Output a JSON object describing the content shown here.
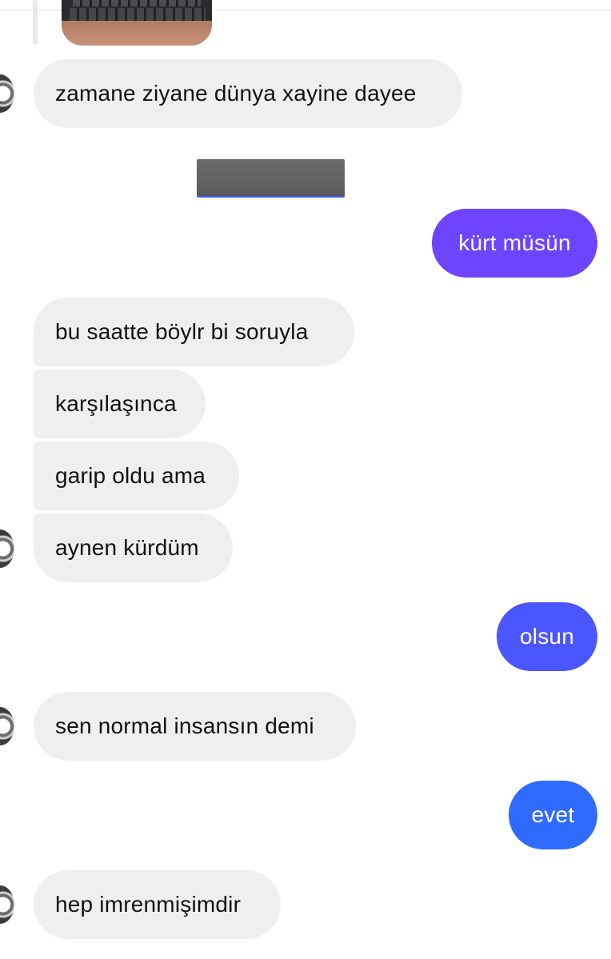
{
  "thread": {
    "messages": [
      {
        "id": "m1",
        "side": "incoming",
        "text": "zamane ziyane dünya xayine dayee"
      },
      {
        "id": "m2",
        "side": "outgoing",
        "text": "kürt müsün",
        "color": "#6e44ff"
      },
      {
        "id": "m3",
        "side": "incoming",
        "text": "bu saatte böylr bi soruyla"
      },
      {
        "id": "m4",
        "side": "incoming",
        "text": "karşılaşınca"
      },
      {
        "id": "m5",
        "side": "incoming",
        "text": "garip oldu ama"
      },
      {
        "id": "m6",
        "side": "incoming",
        "text": "aynen kürdüm"
      },
      {
        "id": "m7",
        "side": "outgoing",
        "text": "olsun",
        "color": "#4a56ff"
      },
      {
        "id": "m8",
        "side": "incoming",
        "text": "sen normal insansın demi"
      },
      {
        "id": "m9",
        "side": "outgoing",
        "text": "evet",
        "color": "#2f6bff"
      },
      {
        "id": "m10",
        "side": "incoming",
        "text": "hep imrenmişimdir"
      }
    ]
  },
  "colors": {
    "incoming_bubble": "#efefef",
    "incoming_text": "#111111",
    "outgoing_text": "#ffffff"
  },
  "icons": {
    "avatar": "profile-avatar-icon",
    "image_preview": "laptop-photo-thumbnail",
    "redacted": "redacted-block"
  }
}
